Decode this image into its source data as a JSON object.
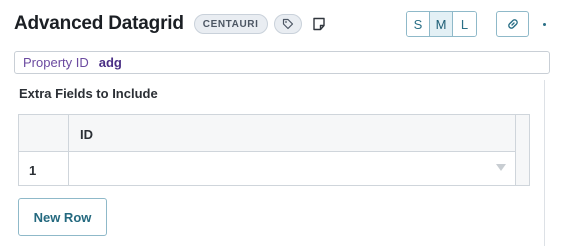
{
  "header": {
    "title": "Advanced Datagrid",
    "badge": "CENTAURI",
    "tag_icon": "tag-icon",
    "note_icon": "note-icon",
    "sizes": [
      "S",
      "M",
      "L"
    ],
    "active_size": "M",
    "link_icon": "link-icon",
    "more_icon": "more-vertical-icon"
  },
  "property": {
    "label": "Property ID",
    "value": "adg"
  },
  "section": {
    "label": "Extra Fields to Include"
  },
  "grid": {
    "columns": [
      "ID"
    ],
    "rows": [
      {
        "number": "1",
        "value": ""
      }
    ],
    "dropdown_icon": "caret-down-icon"
  },
  "actions": {
    "new_row_label": "New Row"
  },
  "colors": {
    "accent": "#2a6f86",
    "property_label": "#6b4aa0",
    "property_value": "#4a2f85"
  }
}
